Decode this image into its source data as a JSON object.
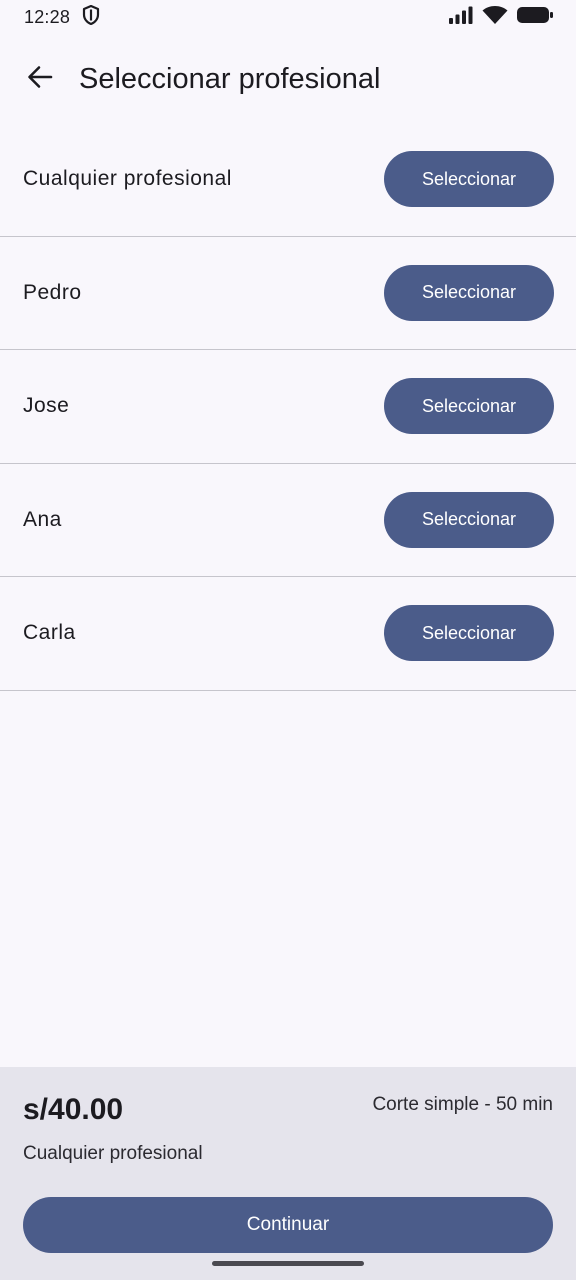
{
  "status_bar": {
    "time": "12:28",
    "icons": [
      "shield-icon",
      "signal-icon",
      "wifi-icon",
      "battery-icon"
    ]
  },
  "app_bar": {
    "back_icon": "arrow-back-icon",
    "title": "Seleccionar profesional"
  },
  "professionals": [
    {
      "name": "Cualquier profesional",
      "button_label": "Seleccionar"
    },
    {
      "name": "Pedro",
      "button_label": "Seleccionar"
    },
    {
      "name": "Jose",
      "button_label": "Seleccionar"
    },
    {
      "name": "Ana",
      "button_label": "Seleccionar"
    },
    {
      "name": "Carla",
      "button_label": "Seleccionar"
    }
  ],
  "summary": {
    "price": "s/40.00",
    "service": "Corte simple - 50 min",
    "selected_professional": "Cualquier profesional",
    "continue_label": "Continuar"
  },
  "colors": {
    "primary": "#4b5c8a",
    "background": "#f9f7fc",
    "sheet": "#e5e4ec",
    "divider": "#c6c5cc"
  }
}
